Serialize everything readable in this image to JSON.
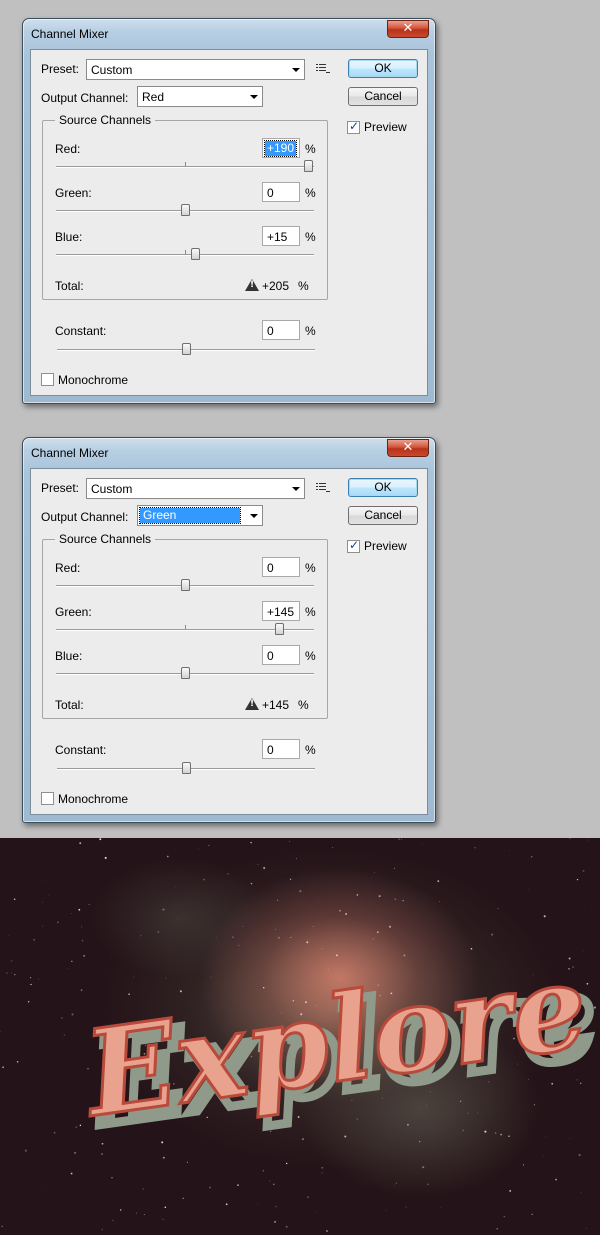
{
  "dialogs": [
    {
      "title": "Channel Mixer",
      "close_glyph": "✕",
      "preset_label": "Preset:",
      "preset_value": "Custom",
      "output_label": "Output Channel:",
      "output_value": "Red",
      "output_selected": false,
      "ok_label": "OK",
      "cancel_label": "Cancel",
      "preview_label": "Preview",
      "preview_checked": true,
      "group_title": "Source Channels",
      "red_label": "Red:",
      "red_value": "+190",
      "red_selected": true,
      "red_level": 190,
      "green_label": "Green:",
      "green_value": "0",
      "green_level": 0,
      "blue_label": "Blue:",
      "blue_value": "+15",
      "blue_level": 15,
      "total_label": "Total:",
      "total_value": "+205",
      "constant_label": "Constant:",
      "constant_value": "0",
      "constant_level": 0,
      "monochrome_label": "Monochrome",
      "monochrome_checked": false,
      "percent": "%"
    },
    {
      "title": "Channel Mixer",
      "close_glyph": "✕",
      "preset_label": "Preset:",
      "preset_value": "Custom",
      "output_label": "Output Channel:",
      "output_value": "Green",
      "output_selected": true,
      "ok_label": "OK",
      "cancel_label": "Cancel",
      "preview_label": "Preview",
      "preview_checked": true,
      "group_title": "Source Channels",
      "red_label": "Red:",
      "red_value": "0",
      "red_selected": false,
      "red_level": 0,
      "green_label": "Green:",
      "green_value": "+145",
      "green_level": 145,
      "blue_label": "Blue:",
      "blue_value": "0",
      "blue_level": 0,
      "total_label": "Total:",
      "total_value": "+145",
      "constant_label": "Constant:",
      "constant_value": "0",
      "constant_level": 0,
      "monochrome_label": "Monochrome",
      "monochrome_checked": false,
      "percent": "%"
    }
  ],
  "artwork": {
    "text": "Explore",
    "text_color": "#e8a28e",
    "outline_color": "#b84a3c",
    "shadow_color": "#8f9a8a",
    "background_color": "#241318"
  }
}
